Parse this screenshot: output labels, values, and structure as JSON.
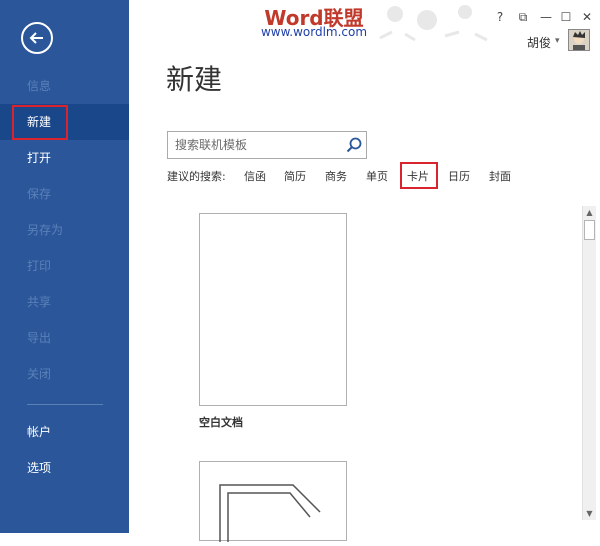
{
  "sidebar": {
    "items": [
      {
        "label": "信息"
      },
      {
        "label": "新建"
      },
      {
        "label": "打开"
      },
      {
        "label": "保存"
      },
      {
        "label": "另存为"
      },
      {
        "label": "打印"
      },
      {
        "label": "共享"
      },
      {
        "label": "导出"
      },
      {
        "label": "关闭"
      },
      {
        "label": "帐户"
      },
      {
        "label": "选项"
      }
    ]
  },
  "titlebar": {
    "brand": "Word联盟",
    "brand_url": "www.wordlm.com",
    "help": "?",
    "restore": "⧉",
    "minimize": "—",
    "maximize": "☐",
    "close": "✕",
    "user_name": "胡俊"
  },
  "main": {
    "title": "新建",
    "search": {
      "placeholder": "搜索联机模板"
    },
    "suggest_label": "建议的搜索:",
    "suggestions": [
      "信函",
      "简历",
      "商务",
      "单页",
      "卡片",
      "日历",
      "封面"
    ],
    "templates": [
      {
        "label": "空白文档"
      }
    ]
  },
  "colors": {
    "sidebar_bg": "#2b579a",
    "highlight": "#d9232e"
  }
}
